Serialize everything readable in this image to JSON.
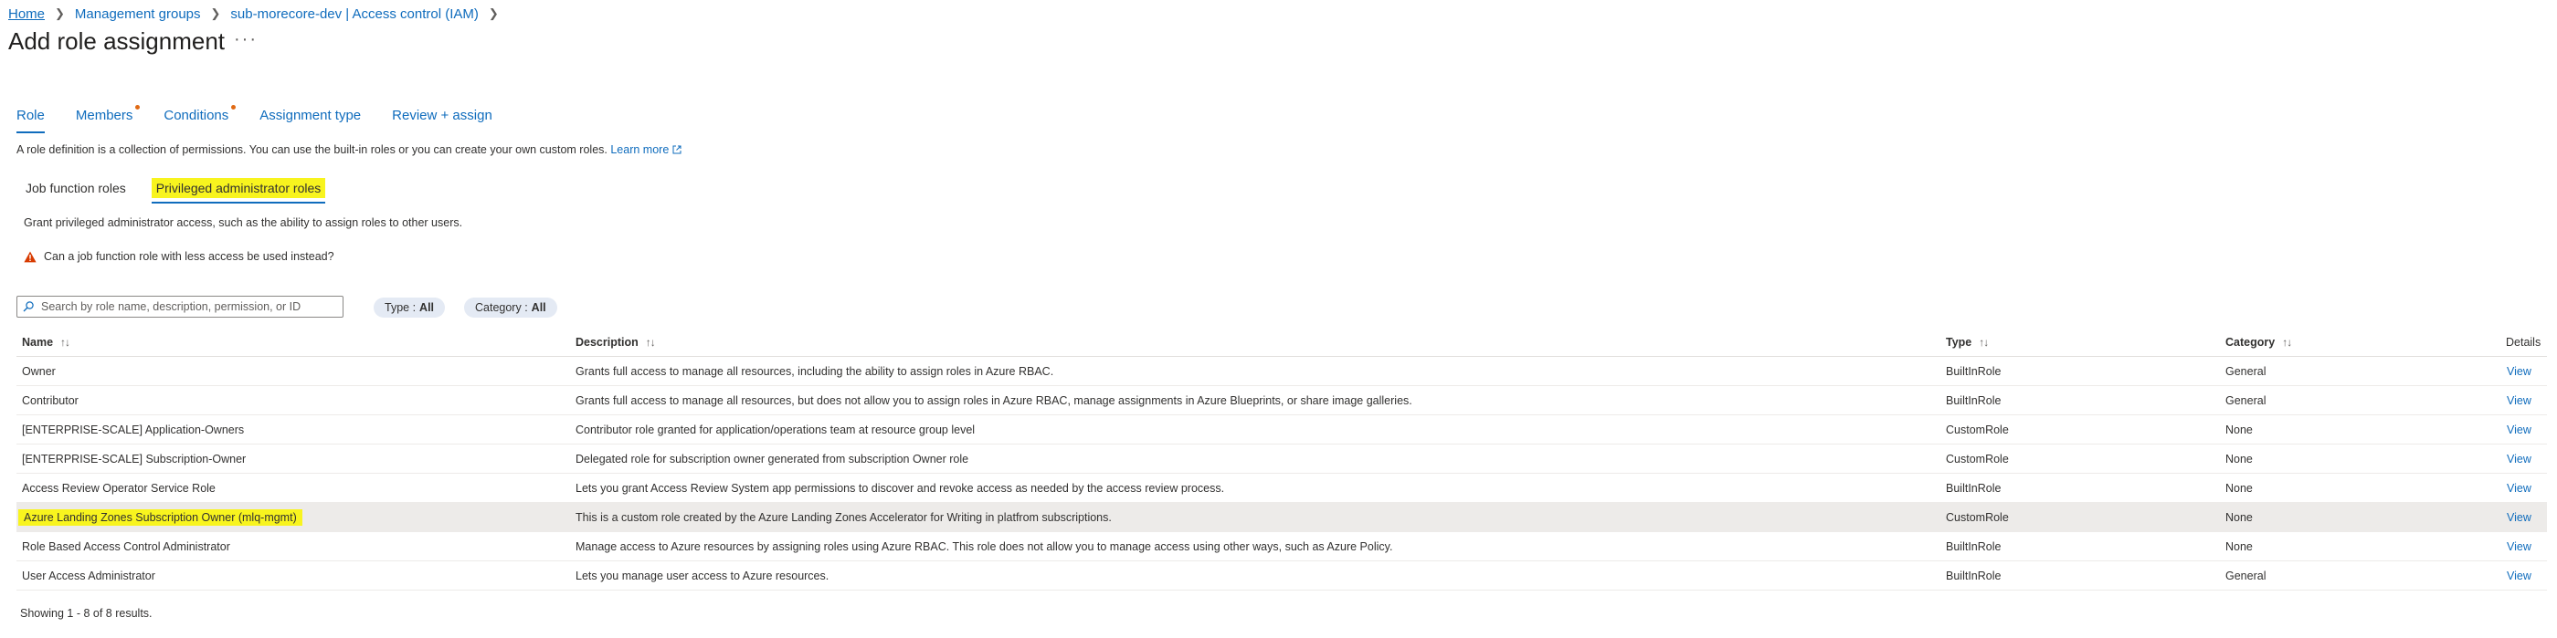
{
  "breadcrumb": {
    "items": [
      "Home",
      "Management groups",
      "sub-morecore-dev | Access control (IAM)"
    ]
  },
  "page": {
    "title": "Add role assignment",
    "more": "···"
  },
  "wizard_tabs": [
    {
      "label": "Role",
      "active": true,
      "required": false
    },
    {
      "label": "Members",
      "active": false,
      "required": true
    },
    {
      "label": "Conditions",
      "active": false,
      "required": true
    },
    {
      "label": "Assignment type",
      "active": false,
      "required": false
    },
    {
      "label": "Review + assign",
      "active": false,
      "required": false
    }
  ],
  "role_description": {
    "text": "A role definition is a collection of permissions. You can use the built-in roles or you can create your own custom roles.",
    "learn_more": "Learn more"
  },
  "role_tabs": {
    "job_function": "Job function roles",
    "privileged": "Privileged administrator roles"
  },
  "grant_text": "Grant privileged administrator access, such as the ability to assign roles to other users.",
  "warning_text": "Can a job function role with less access be used instead?",
  "search": {
    "placeholder": "Search by role name, description, permission, or ID"
  },
  "filters": {
    "type_label": "Type :",
    "type_value": "All",
    "category_label": "Category :",
    "category_value": "All"
  },
  "table": {
    "headers": {
      "name": "Name",
      "description": "Description",
      "type": "Type",
      "category": "Category",
      "details": "Details"
    },
    "rows": [
      {
        "name": "Owner",
        "description": "Grants full access to manage all resources, including the ability to assign roles in Azure RBAC.",
        "type": "BuiltInRole",
        "category": "General",
        "details": "View"
      },
      {
        "name": "Contributor",
        "description": "Grants full access to manage all resources, but does not allow you to assign roles in Azure RBAC, manage assignments in Azure Blueprints, or share image galleries.",
        "type": "BuiltInRole",
        "category": "General",
        "details": "View"
      },
      {
        "name": "[ENTERPRISE-SCALE] Application-Owners",
        "description": "Contributor role granted for application/operations team at resource group level",
        "type": "CustomRole",
        "category": "None",
        "details": "View"
      },
      {
        "name": "[ENTERPRISE-SCALE] Subscription-Owner",
        "description": "Delegated role for subscription owner generated from subscription Owner role",
        "type": "CustomRole",
        "category": "None",
        "details": "View"
      },
      {
        "name": "Access Review Operator Service Role",
        "description": "Lets you grant Access Review System app permissions to discover and revoke access as needed by the access review process.",
        "type": "BuiltInRole",
        "category": "None",
        "details": "View"
      },
      {
        "name": "Azure Landing Zones Subscription Owner (mlq-mgmt)",
        "description": "This is a custom role created by the Azure Landing Zones Accelerator for Writing in platfrom subscriptions.",
        "type": "CustomRole",
        "category": "None",
        "details": "View",
        "selected": true
      },
      {
        "name": "Role Based Access Control Administrator",
        "description": "Manage access to Azure resources by assigning roles using Azure RBAC. This role does not allow you to manage access using other ways, such as Azure Policy.",
        "type": "BuiltInRole",
        "category": "None",
        "details": "View"
      },
      {
        "name": "User Access Administrator",
        "description": "Lets you manage user access to Azure resources.",
        "type": "BuiltInRole",
        "category": "General",
        "details": "View"
      }
    ]
  },
  "footer": {
    "count_text": "Showing 1 - 8 of 8 results."
  },
  "colors": {
    "accent": "#0f6cbd",
    "highlight": "#f8f41e",
    "required_dot": "#e06a14",
    "warning": "#d83b01"
  }
}
